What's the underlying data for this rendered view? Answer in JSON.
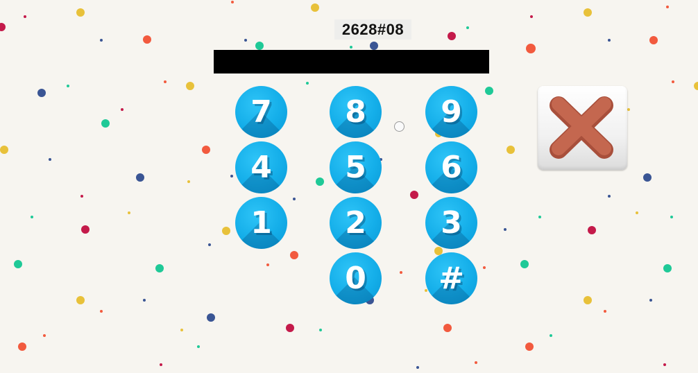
{
  "entered_code": "2628#08",
  "keypad": {
    "keys": [
      "7",
      "8",
      "9",
      "4",
      "5",
      "6",
      "1",
      "2",
      "3",
      "0",
      "#"
    ]
  },
  "close_button": {
    "icon": "close-x-icon",
    "color": "#c4674f"
  },
  "colors": {
    "background": "#f7f5f0",
    "key_blue": "#14aee9",
    "display_bar": "#000000",
    "confetti": [
      "#e8c13a",
      "#f25a3e",
      "#c41a4a",
      "#1fc997",
      "#3a5594"
    ]
  }
}
